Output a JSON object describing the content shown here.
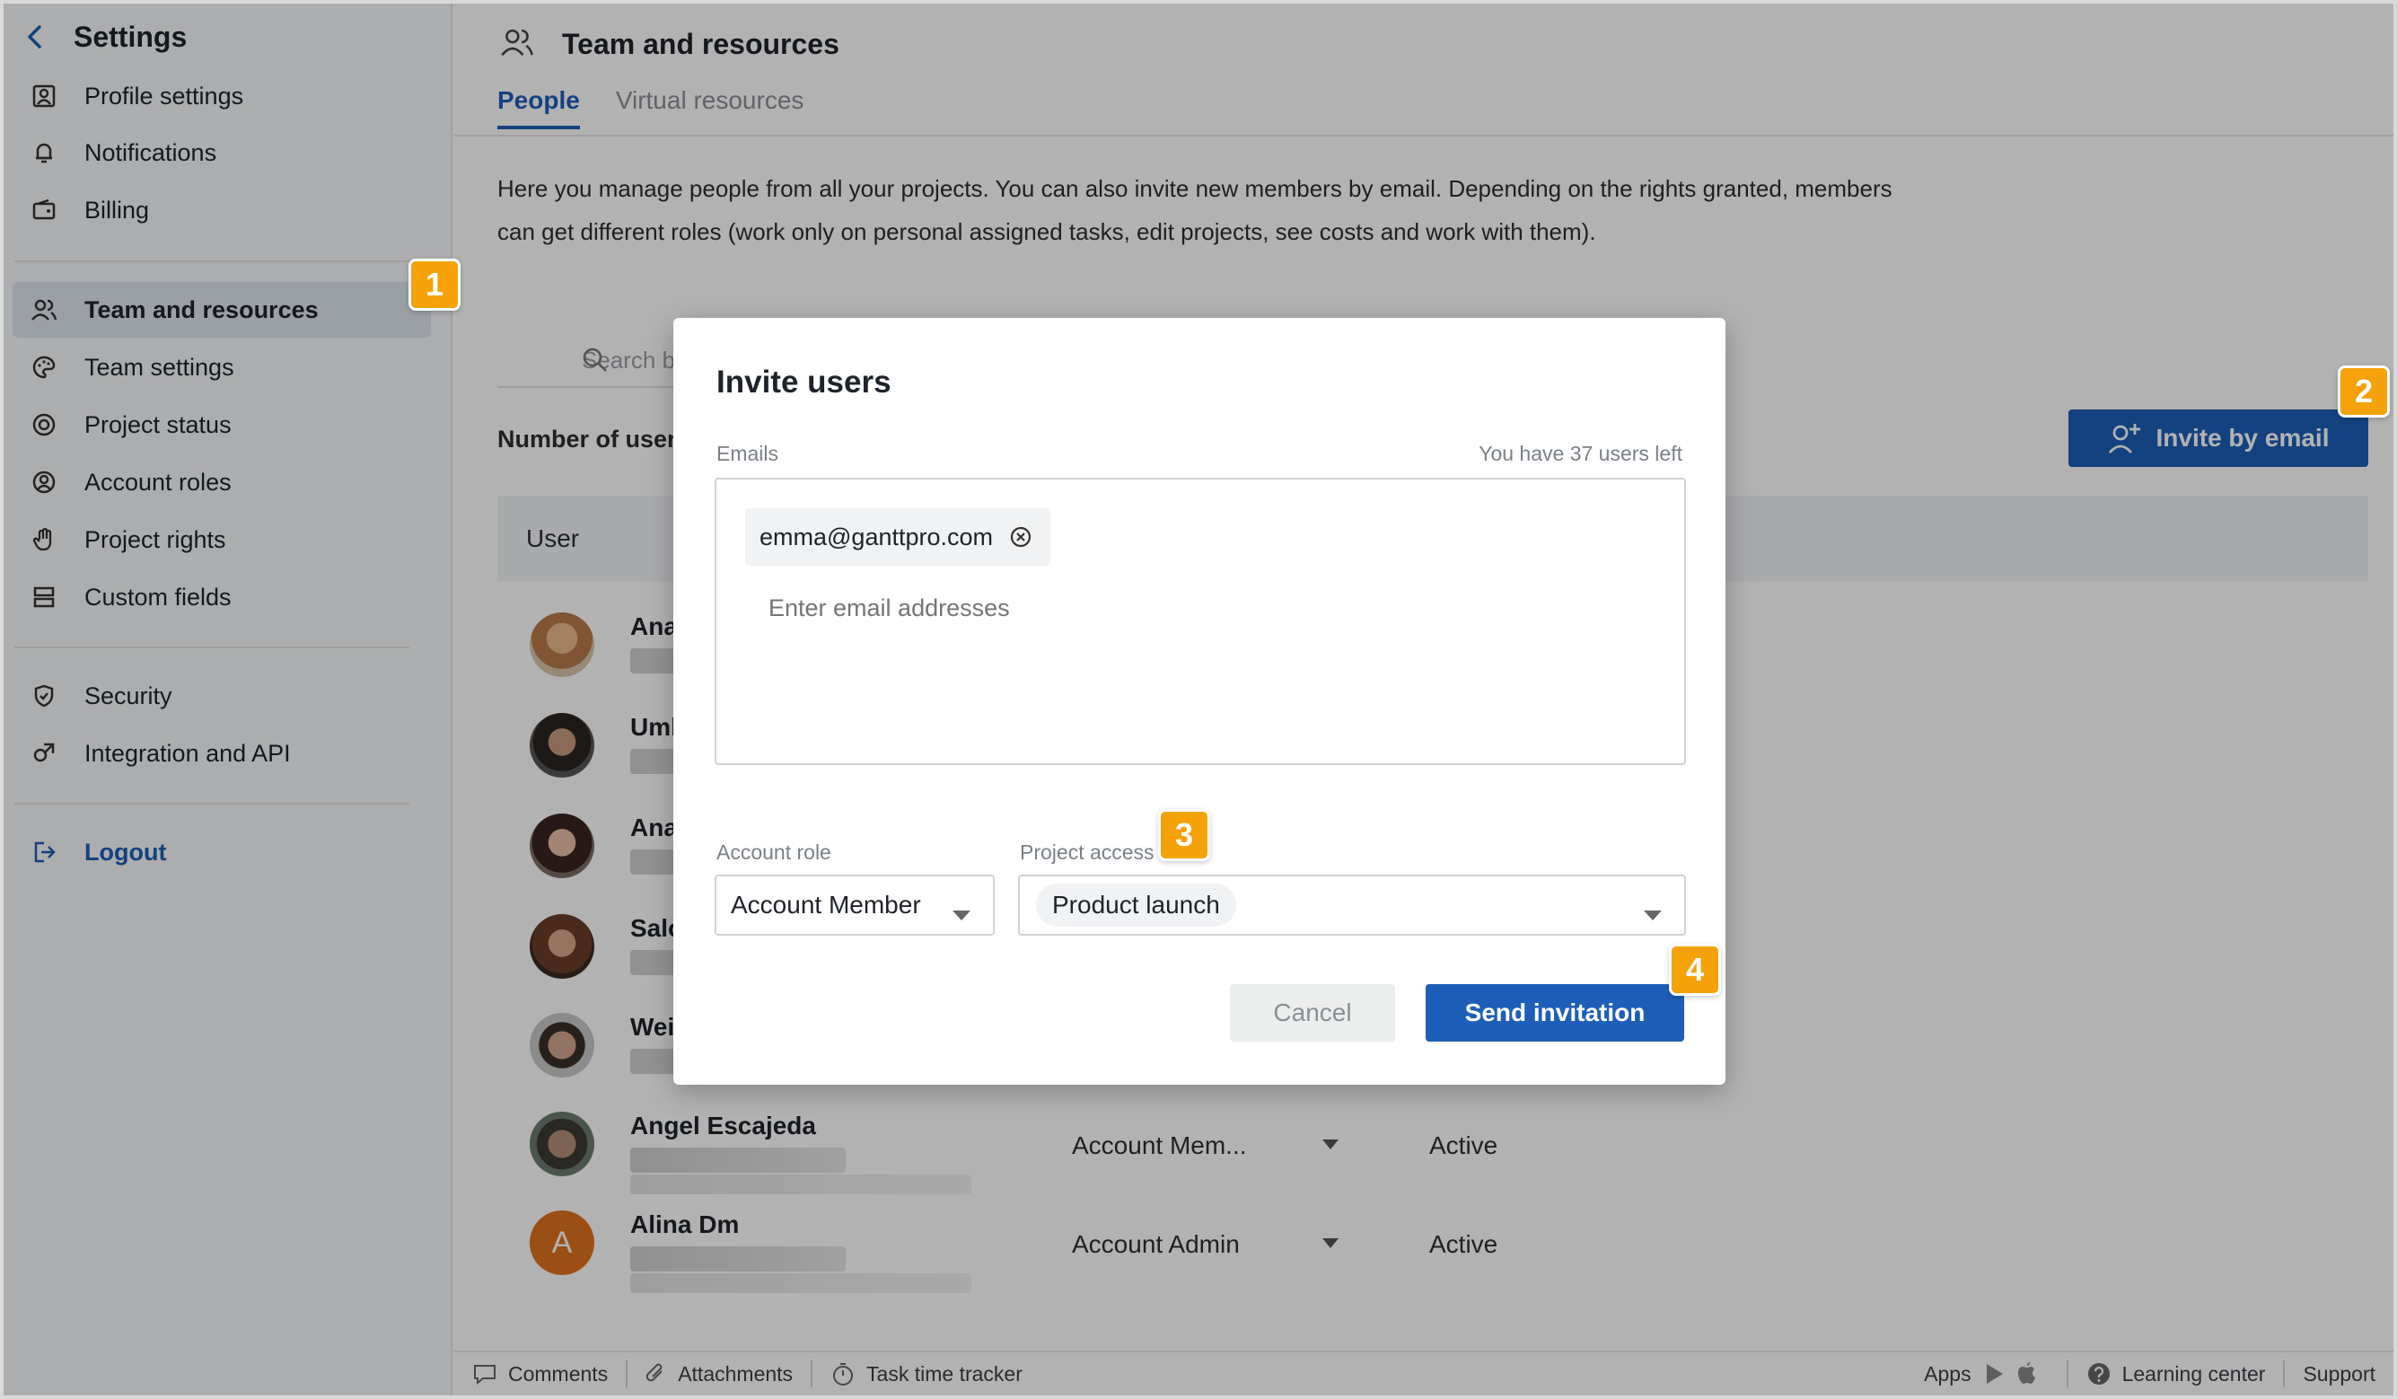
{
  "sidebar": {
    "title": "Settings",
    "items": [
      {
        "label": "Profile settings",
        "icon": "profile-icon"
      },
      {
        "label": "Notifications",
        "icon": "bell-icon"
      },
      {
        "label": "Billing",
        "icon": "billing-icon"
      },
      {
        "label": "Team and resources",
        "icon": "team-icon",
        "active": true
      },
      {
        "label": "Team settings",
        "icon": "palette-icon"
      },
      {
        "label": "Project status",
        "icon": "status-icon"
      },
      {
        "label": "Account roles",
        "icon": "account-roles-icon"
      },
      {
        "label": "Project rights",
        "icon": "hand-icon"
      },
      {
        "label": "Custom fields",
        "icon": "custom-fields-icon"
      },
      {
        "label": "Security",
        "icon": "shield-icon"
      },
      {
        "label": "Integration and API",
        "icon": "integration-icon"
      }
    ],
    "logout": "Logout"
  },
  "main": {
    "title": "Team and resources",
    "tabs": [
      {
        "label": "People",
        "active": true
      },
      {
        "label": "Virtual resources",
        "active": false
      }
    ],
    "description": "Here you manage people from all your projects. You can also invite new members by email. Depending on the rights granted, members can get different roles (work only on personal assigned tasks, edit projects, see costs and work with them).",
    "search_placeholder": "Search b",
    "users_count_label": "Number of users",
    "invite_button": "Invite by email",
    "table_header": "User",
    "rows": [
      {
        "name": "Ana",
        "role": "",
        "status": ""
      },
      {
        "name": "Umb",
        "role": "",
        "status": ""
      },
      {
        "name": "Ana",
        "role": "",
        "status": ""
      },
      {
        "name": "Salo",
        "role": "",
        "status": ""
      },
      {
        "name": "Wei",
        "role": "",
        "status": ""
      },
      {
        "name": "Angel Escajeda",
        "role": "Account Mem...",
        "status": "Active"
      },
      {
        "name": "Alina Dm",
        "role": "Account Admin",
        "status": "Active",
        "initial": "A"
      }
    ]
  },
  "footer": {
    "comments": "Comments",
    "attachments": "Attachments",
    "task_time_tracker": "Task time tracker",
    "apps": "Apps",
    "learning_center": "Learning center",
    "support": "Support"
  },
  "modal": {
    "title": "Invite users",
    "emails_label": "Emails",
    "users_left": "You have 37 users left",
    "chip_email": "emma@ganttpro.com",
    "email_placeholder": "Enter email addresses",
    "account_role_label": "Account role",
    "account_role_value": "Account Member",
    "project_access_label": "Project access",
    "project_access_value": "Product launch",
    "cancel": "Cancel",
    "send": "Send invitation"
  },
  "badges": [
    "1",
    "2",
    "3",
    "4"
  ],
  "colors": {
    "accent": "#1d5fb8",
    "badge": "#f5a20a"
  }
}
